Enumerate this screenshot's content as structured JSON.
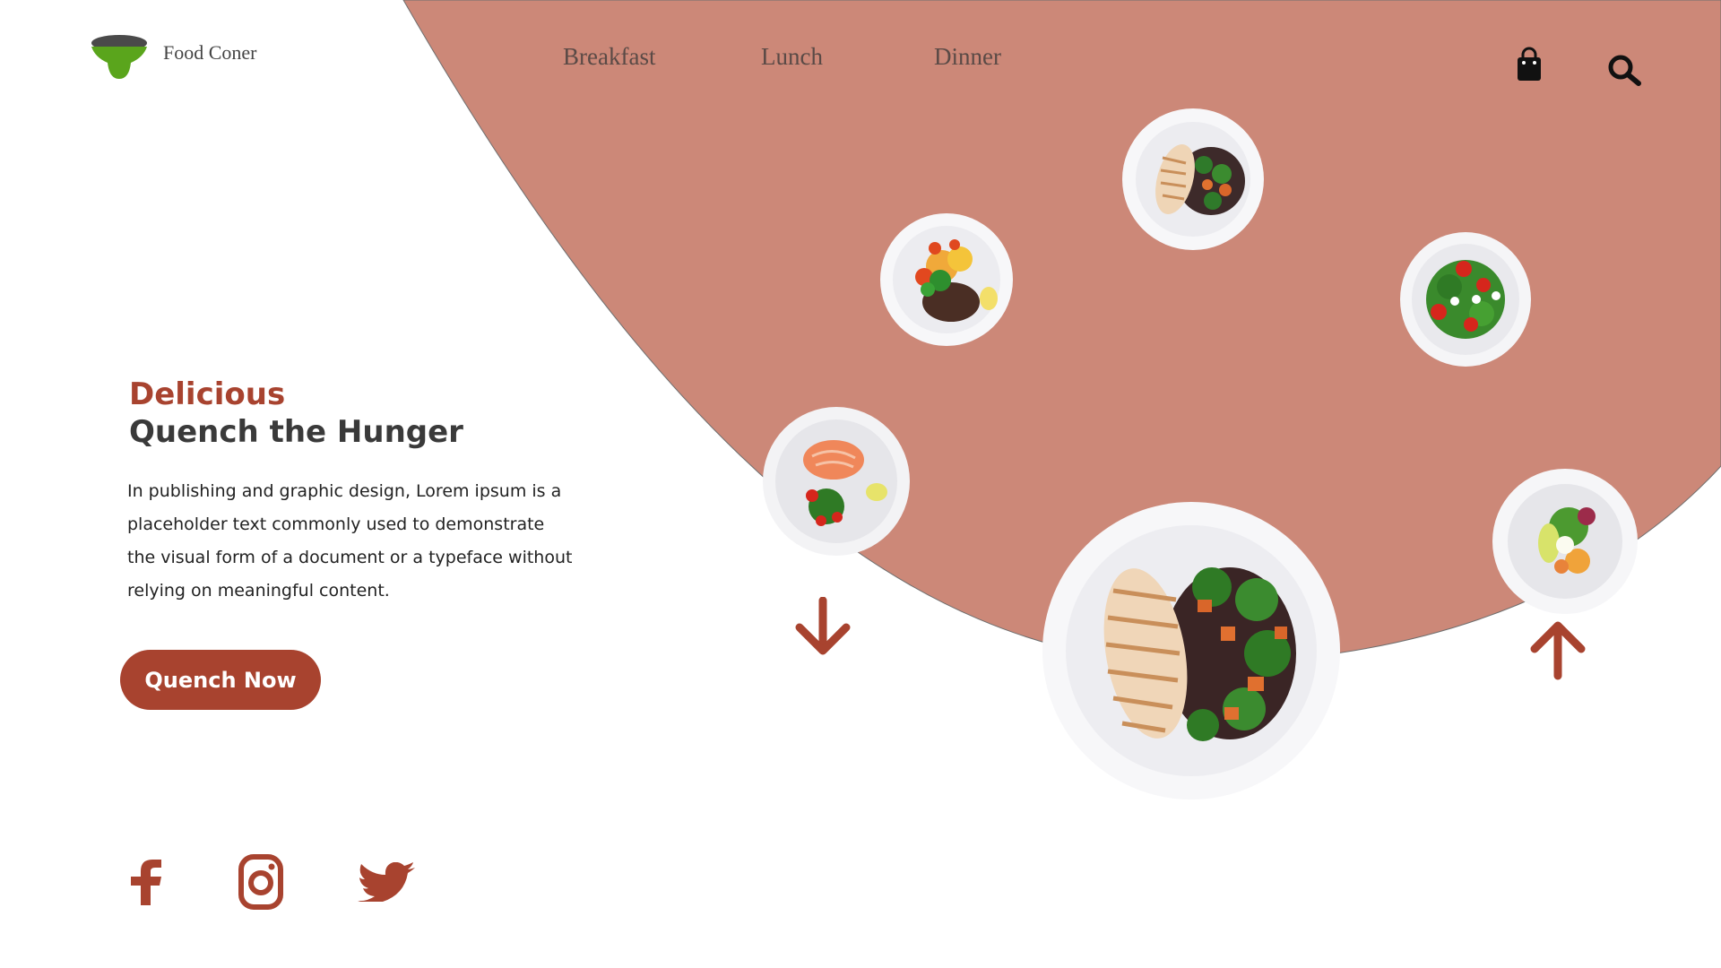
{
  "brand": {
    "name": "Food Coner"
  },
  "nav": {
    "items": [
      {
        "label": "Breakfast"
      },
      {
        "label": "Lunch"
      },
      {
        "label": "Dinner"
      }
    ],
    "icons": [
      "shopping-bag-icon",
      "search-icon"
    ]
  },
  "hero": {
    "eyebrow": "Delicious",
    "title": "Quench the Hunger",
    "body": "In publishing and graphic design, Lorem ipsum is a placeholder text commonly used to demonstrate the visual form of a document or a typeface without relying on meaningful content.",
    "cta_label": "Quench Now"
  },
  "dishes": [
    "chicken-quinoa-plate",
    "veggie-lentil-plate",
    "tomato-arugula-salad-plate",
    "salmon-salad-plate",
    "large-chicken-quinoa-plate",
    "mixed-salad-bowl"
  ],
  "social": [
    "facebook-icon",
    "instagram-icon",
    "twitter-icon"
  ],
  "colors": {
    "accent": "#a8432f",
    "blob": "#cc8878",
    "text_dark": "#3a3a3a",
    "logo_green": "#5aa51c",
    "logo_grey": "#4a4a4a"
  }
}
